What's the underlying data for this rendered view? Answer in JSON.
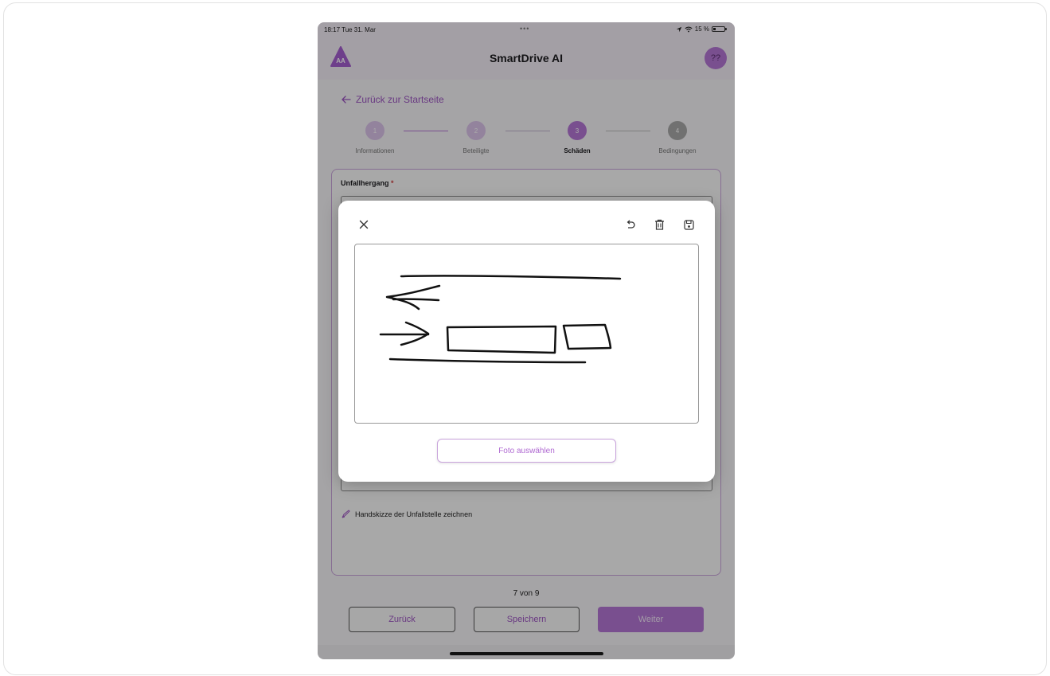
{
  "status_bar": {
    "time": "18:17  Tue 31. Mar",
    "dots": "•••",
    "battery": "15 %"
  },
  "header": {
    "title": "SmartDrive AI",
    "avatar": "??"
  },
  "back_link": {
    "label": "Zurück zur Startseite"
  },
  "stepper": {
    "steps": [
      {
        "number": "1",
        "label": "Informationen",
        "state": "done"
      },
      {
        "number": "2",
        "label": "Beteiligte",
        "state": "done"
      },
      {
        "number": "3",
        "label": "Schäden",
        "state": "active"
      },
      {
        "number": "4",
        "label": "Bedingungen",
        "state": "pending"
      }
    ]
  },
  "form": {
    "field_label": "Unfallhergang",
    "required_marker": "*",
    "sketch_link": "Handskizze der Unfallstelle zeichnen"
  },
  "pagination": {
    "counter": "7 von 9"
  },
  "nav": {
    "back": "Zurück",
    "save": "Speichern",
    "next": "Weiter"
  },
  "modal": {
    "photo_button": "Foto auswählen",
    "toolbar_icons": [
      "close-icon",
      "undo-icon",
      "trash-icon",
      "save-icon"
    ]
  },
  "colors": {
    "accent": "#b577d6",
    "accent_text": "#9d55c2",
    "overlay": "rgba(0,0,0,0.33)"
  }
}
